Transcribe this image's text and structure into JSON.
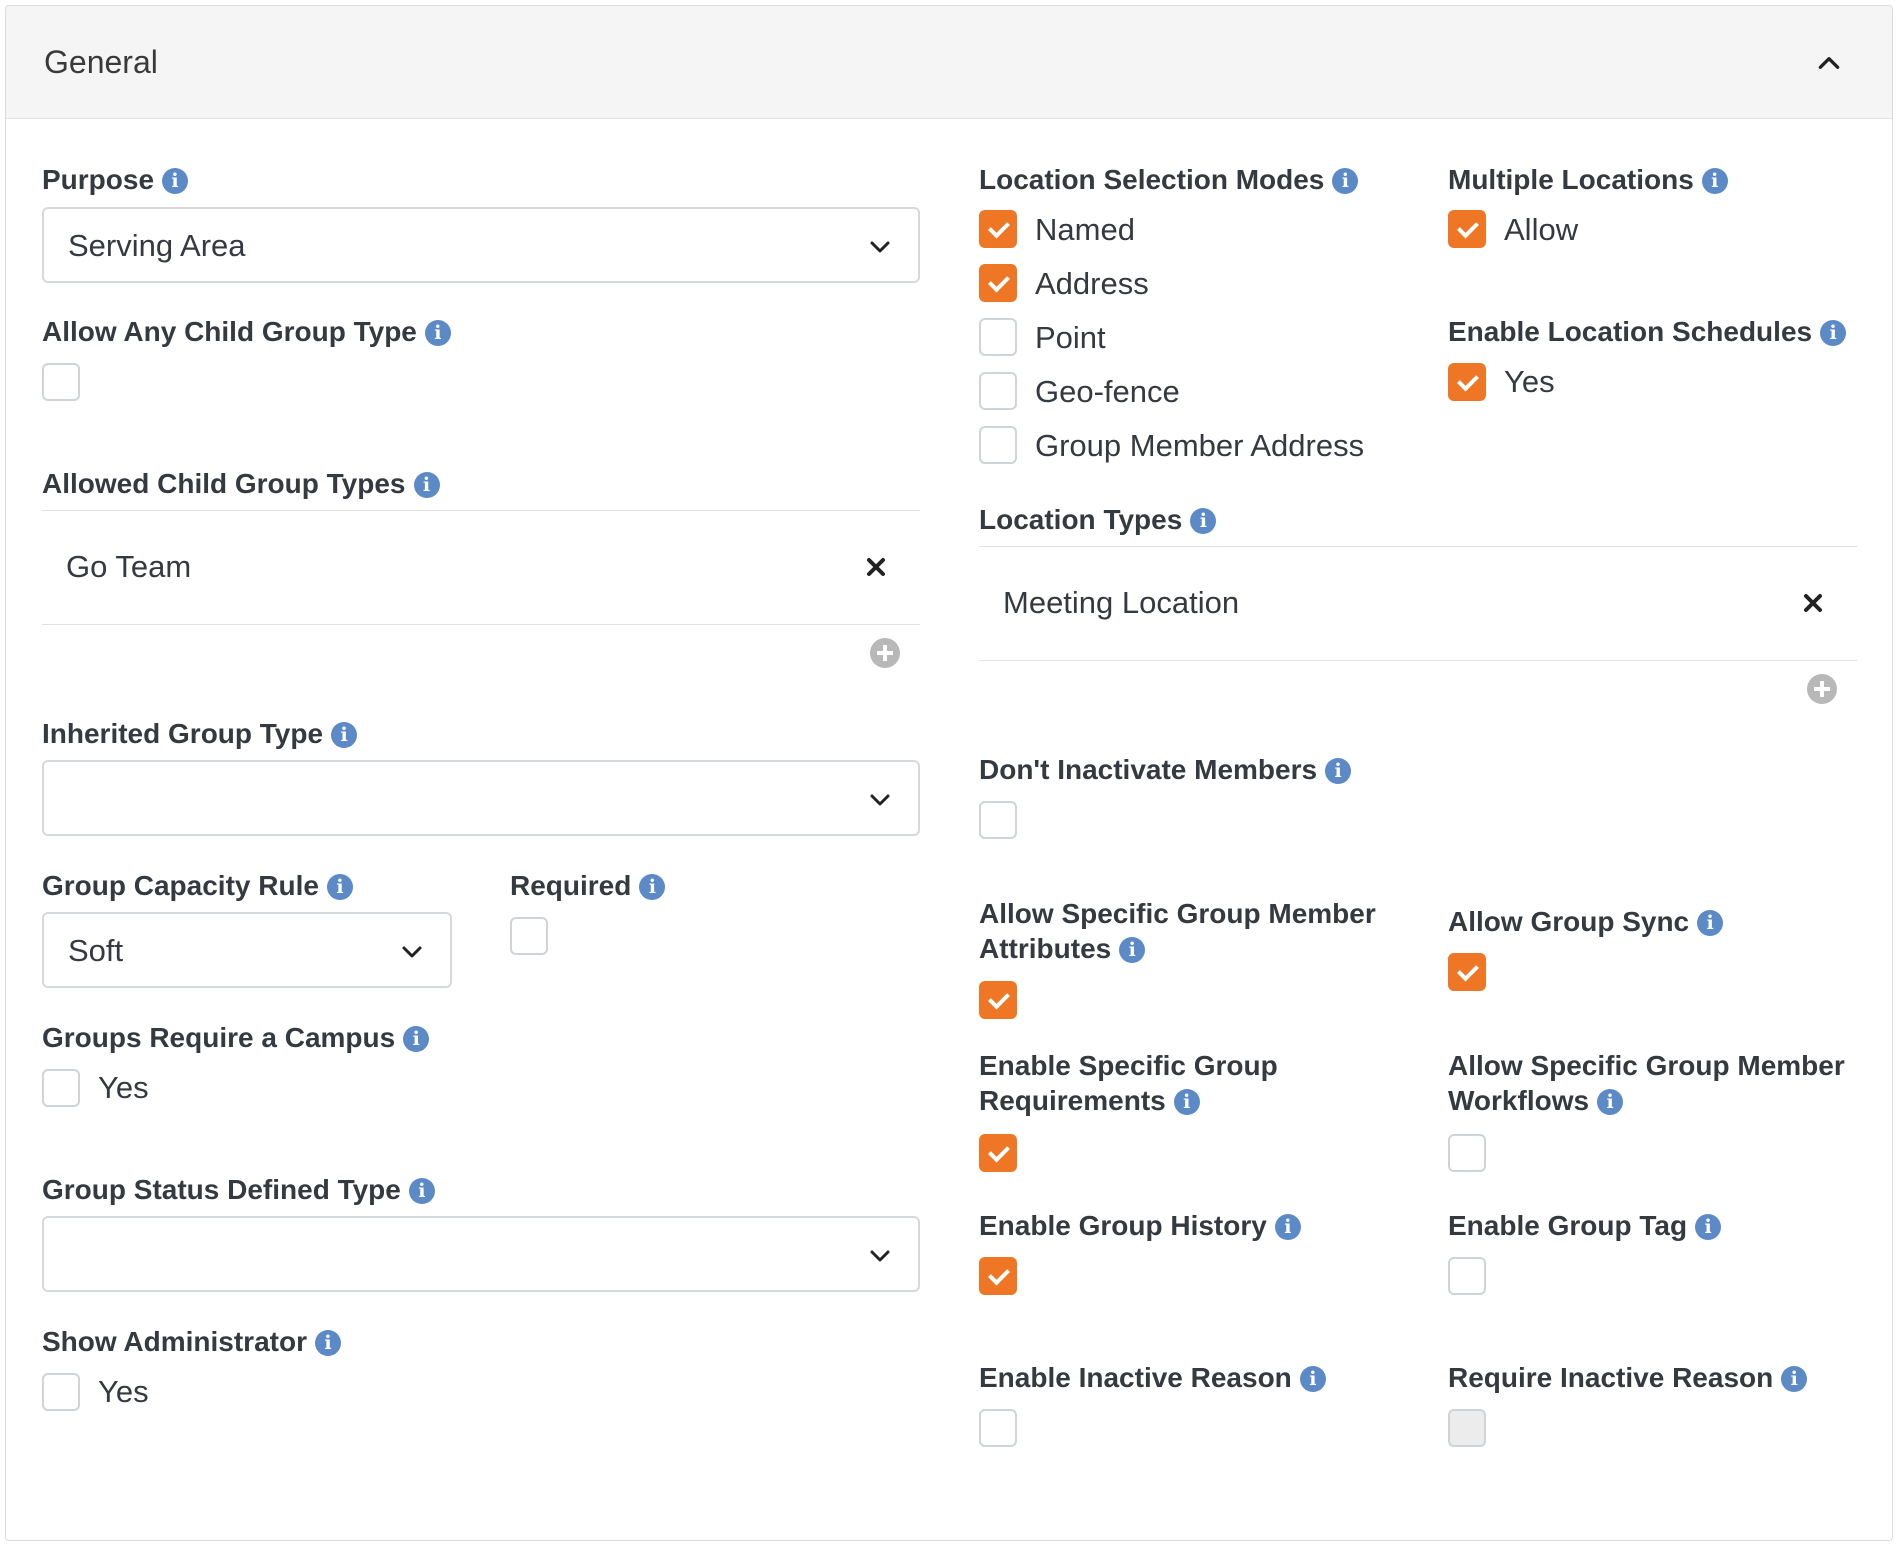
{
  "panel": {
    "title": "General"
  },
  "left": {
    "purpose": {
      "label": "Purpose",
      "value": "Serving Area"
    },
    "allow_any_child": {
      "label": "Allow Any Child Group Type",
      "checked": false
    },
    "allowed_child_types": {
      "label": "Allowed Child Group Types",
      "items": [
        "Go Team"
      ]
    },
    "inherited_group_type": {
      "label": "Inherited Group Type",
      "value": ""
    },
    "group_capacity_rule": {
      "label": "Group Capacity Rule",
      "value": "Soft"
    },
    "required": {
      "label": "Required",
      "checked": false
    },
    "groups_require_campus": {
      "label": "Groups Require a Campus",
      "option": "Yes",
      "checked": false
    },
    "group_status_defined_type": {
      "label": "Group Status Defined Type",
      "value": ""
    },
    "show_administrator": {
      "label": "Show Administrator",
      "option": "Yes",
      "checked": false
    }
  },
  "right": {
    "location_selection_modes": {
      "label": "Location Selection Modes",
      "options": [
        {
          "label": "Named",
          "checked": true
        },
        {
          "label": "Address",
          "checked": true
        },
        {
          "label": "Point",
          "checked": false
        },
        {
          "label": "Geo-fence",
          "checked": false
        },
        {
          "label": "Group Member Address",
          "checked": false
        }
      ]
    },
    "multiple_locations": {
      "label": "Multiple Locations",
      "option": "Allow",
      "checked": true
    },
    "enable_location_schedules": {
      "label": "Enable Location Schedules",
      "option": "Yes",
      "checked": true
    },
    "location_types": {
      "label": "Location Types",
      "items": [
        "Meeting Location"
      ]
    },
    "dont_inactivate_members": {
      "label": "Don't Inactivate Members",
      "checked": false
    },
    "allow_specific_member_attributes": {
      "label": "Allow Specific Group Member Attributes",
      "checked": true
    },
    "allow_group_sync": {
      "label": "Allow Group Sync",
      "checked": true
    },
    "enable_specific_requirements": {
      "label": "Enable Specific Group Requirements",
      "checked": true
    },
    "allow_specific_member_workflows": {
      "label": "Allow Specific Group Member Workflows",
      "checked": false
    },
    "enable_group_history": {
      "label": "Enable Group History",
      "checked": true
    },
    "enable_group_tag": {
      "label": "Enable Group Tag",
      "checked": false
    },
    "enable_inactive_reason": {
      "label": "Enable Inactive Reason",
      "checked": false
    },
    "require_inactive_reason": {
      "label": "Require Inactive Reason",
      "checked": false,
      "disabled": true
    }
  },
  "icons": {
    "info": "info-icon",
    "chevron": "chevron-down-icon",
    "remove": "close-icon",
    "add": "add-circle-icon",
    "collapse": "chevron-up-icon"
  },
  "colors": {
    "accent": "#ee7624",
    "info": "#5b8ac7",
    "header_bg": "#f5f5f5"
  }
}
